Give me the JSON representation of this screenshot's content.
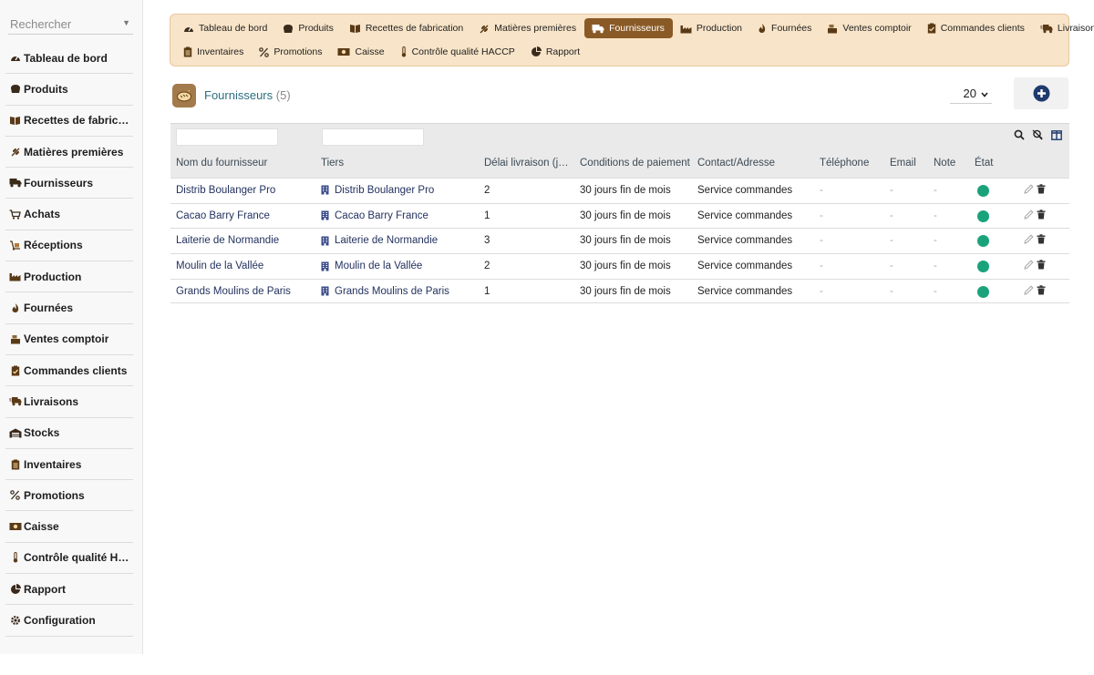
{
  "sidebar": {
    "search_placeholder": "Rechercher",
    "items": [
      {
        "label": "Tableau de bord",
        "icon": "gauge-icon"
      },
      {
        "label": "Produits",
        "icon": "bread-icon"
      },
      {
        "label": "Recettes de fabrication",
        "icon": "book-icon"
      },
      {
        "label": "Matières premières",
        "icon": "wheat-icon"
      },
      {
        "label": "Fournisseurs",
        "icon": "truck-icon"
      },
      {
        "label": "Achats",
        "icon": "cart-icon"
      },
      {
        "label": "Réceptions",
        "icon": "dolly-icon"
      },
      {
        "label": "Production",
        "icon": "factory-icon"
      },
      {
        "label": "Fournées",
        "icon": "fire-icon"
      },
      {
        "label": "Ventes comptoir",
        "icon": "cash-register-icon"
      },
      {
        "label": "Commandes clients",
        "icon": "clipboard-check-icon"
      },
      {
        "label": "Livraisons",
        "icon": "shipping-icon"
      },
      {
        "label": "Stocks",
        "icon": "warehouse-icon"
      },
      {
        "label": "Inventaires",
        "icon": "clipboard-list-icon"
      },
      {
        "label": "Promotions",
        "icon": "percent-icon"
      },
      {
        "label": "Caisse",
        "icon": "money-icon"
      },
      {
        "label": "Contrôle qualité HACCP",
        "icon": "thermometer-icon"
      },
      {
        "label": "Rapport",
        "icon": "pie-chart-icon"
      },
      {
        "label": "Configuration",
        "icon": "gear-icon"
      }
    ]
  },
  "topnav": {
    "row1": [
      {
        "label": "Tableau de bord",
        "icon": "gauge-icon"
      },
      {
        "label": "Produits",
        "icon": "bread-icon"
      },
      {
        "label": "Recettes de fabrication",
        "icon": "book-icon"
      },
      {
        "label": "Matières premières",
        "icon": "wheat-icon"
      },
      {
        "label": "Fournisseurs",
        "icon": "truck-icon",
        "active": true
      },
      {
        "label": "Production",
        "icon": "factory-icon"
      },
      {
        "label": "Fournées",
        "icon": "fire-icon"
      },
      {
        "label": "Ventes comptoir",
        "icon": "cash-register-icon"
      },
      {
        "label": "Commandes clients",
        "icon": "clipboard-check-icon"
      },
      {
        "label": "Livraisons",
        "icon": "shipping-icon"
      }
    ],
    "row2": [
      {
        "label": "Inventaires",
        "icon": "clipboard-list-icon"
      },
      {
        "label": "Promotions",
        "icon": "percent-icon"
      },
      {
        "label": "Caisse",
        "icon": "money-icon"
      },
      {
        "label": "Contrôle qualité HACCP",
        "icon": "thermometer-icon"
      },
      {
        "label": "Rapport",
        "icon": "pie-chart-icon"
      }
    ]
  },
  "page": {
    "title": "Fournisseurs",
    "count": "(5)",
    "page_size": "20"
  },
  "table": {
    "headers": [
      "Nom du fournisseur",
      "Tiers",
      "Délai livraison (j…",
      "Conditions de paiement",
      "Contact/Adresse",
      "Téléphone",
      "Email",
      "Note",
      "État"
    ],
    "rows": [
      {
        "nom": "Distrib Boulanger Pro",
        "tiers": "Distrib Boulanger Pro",
        "delai": "2",
        "conditions": "30 jours fin de mois",
        "contact": "Service commandes",
        "telephone": "-",
        "email": "-",
        "note": "-",
        "etat": "active"
      },
      {
        "nom": "Cacao Barry France",
        "tiers": "Cacao Barry France",
        "delai": "1",
        "conditions": "30 jours fin de mois",
        "contact": "Service commandes",
        "telephone": "-",
        "email": "-",
        "note": "-",
        "etat": "active"
      },
      {
        "nom": "Laiterie de Normandie",
        "tiers": "Laiterie de Normandie",
        "delai": "3",
        "conditions": "30 jours fin de mois",
        "contact": "Service commandes",
        "telephone": "-",
        "email": "-",
        "note": "-",
        "etat": "active"
      },
      {
        "nom": "Moulin de la Vallée",
        "tiers": "Moulin de la Vallée",
        "delai": "2",
        "conditions": "30 jours fin de mois",
        "contact": "Service commandes",
        "telephone": "-",
        "email": "-",
        "note": "-",
        "etat": "active"
      },
      {
        "nom": "Grands Moulins de Paris",
        "tiers": "Grands Moulins de Paris",
        "delai": "1",
        "conditions": "30 jours fin de mois",
        "contact": "Service commandes",
        "telephone": "-",
        "email": "-",
        "note": "-",
        "etat": "active"
      }
    ]
  },
  "colors": {
    "accent": "#8a5a26",
    "nav_bg": "#f8e4c8",
    "title": "#2d6f80",
    "link": "#23325f",
    "status_active": "#1aa37a",
    "add_button": "#1e3a6e"
  }
}
